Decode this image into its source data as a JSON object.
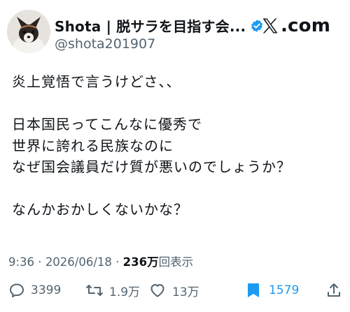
{
  "header": {
    "display_name": "Shota | 脱サラを目指す会...",
    "handle": "@shota201907",
    "brand_text": ".com",
    "icons": [
      "avatar-dog-photo",
      "verified-badge-icon",
      "x-logo-icon"
    ]
  },
  "tweet": {
    "lines": [
      "炎上覚悟で言うけどさ、、",
      "",
      "日本国民ってこんなに優秀で",
      "世界に誇れる民族なのに",
      "なぜ国会議員だけ質が悪いのでしょうか？",
      "",
      "なんかおかしくないかな？"
    ]
  },
  "meta": {
    "time": "9:36",
    "sep": " · ",
    "date": "2026/06/18",
    "views_count": "236万",
    "views_label": "回表示"
  },
  "actions": {
    "reply_count": "3399",
    "retweet_count": "1.9万",
    "like_count": "13万",
    "bookmark_count": "1579",
    "icons": [
      "reply-icon",
      "retweet-icon",
      "like-icon",
      "bookmark-icon",
      "share-icon"
    ]
  },
  "colors": {
    "text": "#0f1419",
    "secondary": "#536471",
    "accent": "#1d9bf0",
    "background": "#ffffff"
  }
}
